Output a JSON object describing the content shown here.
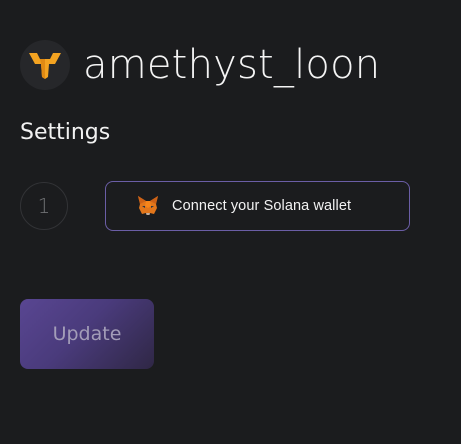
{
  "profile": {
    "username": "amethyst_loon",
    "logo_icon": "flame-logo-icon",
    "logo_color": "#f3a321"
  },
  "settings": {
    "title": "Settings",
    "step_number": "1",
    "connect_wallet_label": "Connect your Solana wallet",
    "wallet_icon": "metamask-fox-icon",
    "accent_border": "#6b5ea6"
  },
  "actions": {
    "update_label": "Update",
    "update_color": "#594692"
  }
}
